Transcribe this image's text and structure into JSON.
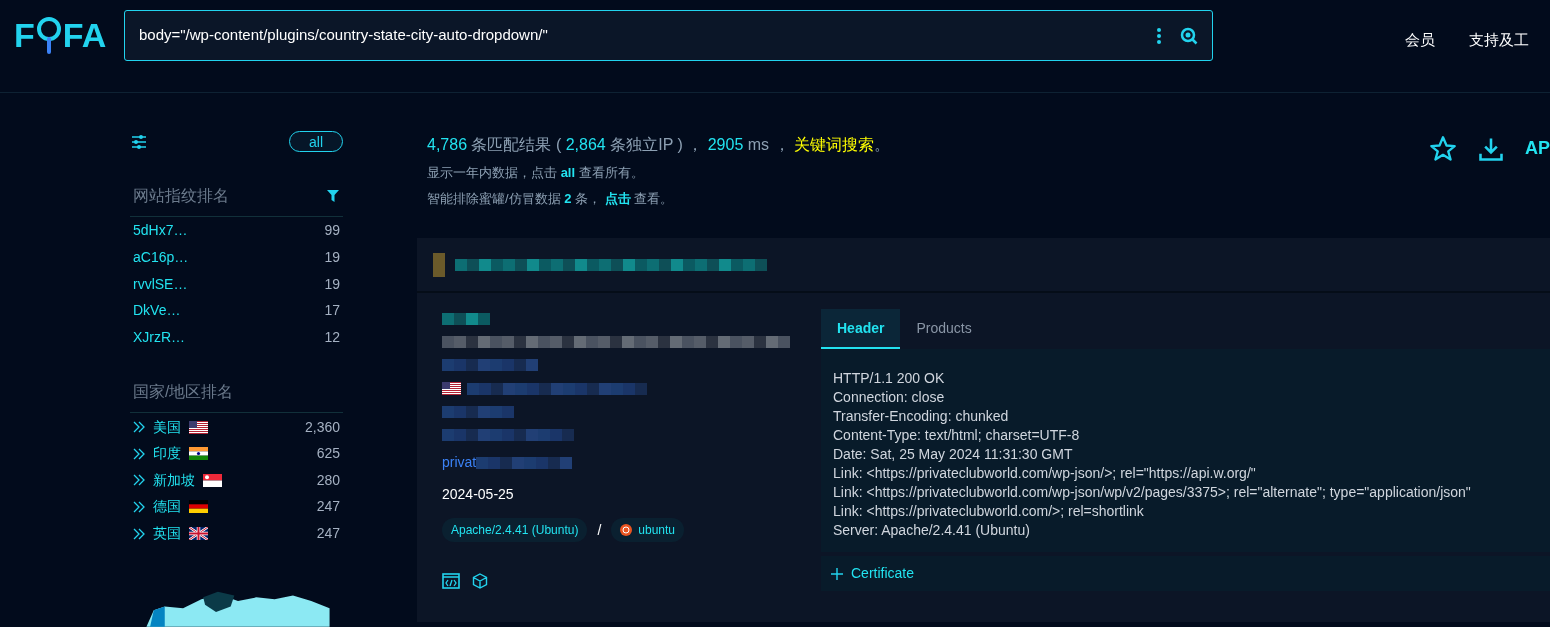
{
  "logo": {
    "before": "F",
    "after": "FA"
  },
  "search": {
    "value": "body=\"/wp-content/plugins/country-state-city-auto-dropdown/\""
  },
  "nav": [
    "会员",
    "支持及工"
  ],
  "sidebar": {
    "all_button": "all",
    "fingerprint": {
      "title": "网站指纹排名",
      "items": [
        {
          "name": "5dHx7…",
          "count": "99"
        },
        {
          "name": "aC16p…",
          "count": "19"
        },
        {
          "name": "rvvlSE…",
          "count": "19"
        },
        {
          "name": "DkVe…",
          "count": "17"
        },
        {
          "name": "XJrzR…",
          "count": "12"
        }
      ]
    },
    "countries": {
      "title": "国家/地区排名",
      "items": [
        {
          "name": "美国",
          "kind": "us",
          "count": "2,360"
        },
        {
          "name": "印度",
          "kind": "in",
          "count": "625"
        },
        {
          "name": "新加坡",
          "kind": "sg",
          "count": "280"
        },
        {
          "name": "德国",
          "kind": "de",
          "count": "247"
        },
        {
          "name": "英国",
          "kind": "gb",
          "count": "247"
        }
      ]
    }
  },
  "summary": {
    "line1": [
      {
        "kind": "accent",
        "text": "4,786"
      },
      {
        "kind": "plain",
        "text": " 条匹配结果 ( "
      },
      {
        "kind": "accent",
        "text": "2,864"
      },
      {
        "kind": "plain",
        "text": " 条独立IP ) ， "
      },
      {
        "kind": "accent",
        "text": "2905"
      },
      {
        "kind": "plain",
        "text": " ms ， "
      },
      {
        "kind": "link",
        "text": "关键词搜索"
      },
      {
        "kind": "plain",
        "text": "。"
      }
    ],
    "line2": [
      {
        "kind": "plain",
        "text": "显示一年内数据，点击 "
      },
      {
        "kind": "bold",
        "text": "all"
      },
      {
        "kind": "plain",
        "text": " 查看所有。"
      }
    ],
    "line3": [
      {
        "kind": "plain",
        "text": "智能排除蜜罐/仿冒数据 "
      },
      {
        "kind": "bold",
        "text": "2"
      },
      {
        "kind": "plain",
        "text": " 条， "
      },
      {
        "kind": "bold",
        "text": "点击"
      },
      {
        "kind": "plain",
        "text": " 查看。"
      }
    ],
    "api": "AP"
  },
  "result": {
    "link_prefix": "privat",
    "date": "2024-05-25",
    "tags": [
      {
        "kind": "server",
        "text": "Apache/2.4.41 (Ubuntu)"
      },
      {
        "kind": "os",
        "text": "ubuntu"
      }
    ],
    "separator": "/",
    "tabs": [
      {
        "label": "Header",
        "selected": true
      },
      {
        "label": "Products",
        "selected": false
      }
    ],
    "header_lines": [
      "HTTP/1.1 200 OK",
      "Connection: close",
      "Transfer-Encoding: chunked",
      "Content-Type: text/html; charset=UTF-8",
      "Date: Sat, 25 May 2024 11:31:30 GMT",
      "Link: <https://privateclubworld.com/wp-json/>; rel=\"https://api.w.org/\"",
      "Link: <https://privateclubworld.com/wp-json/wp/v2/pages/3375>; rel=\"alternate\"; type=\"application/json\"",
      "Link: <https://privateclubworld.com/>; rel=shortlink",
      "Server: Apache/2.4.41 (Ubuntu)"
    ],
    "certificate": "Certificate"
  }
}
